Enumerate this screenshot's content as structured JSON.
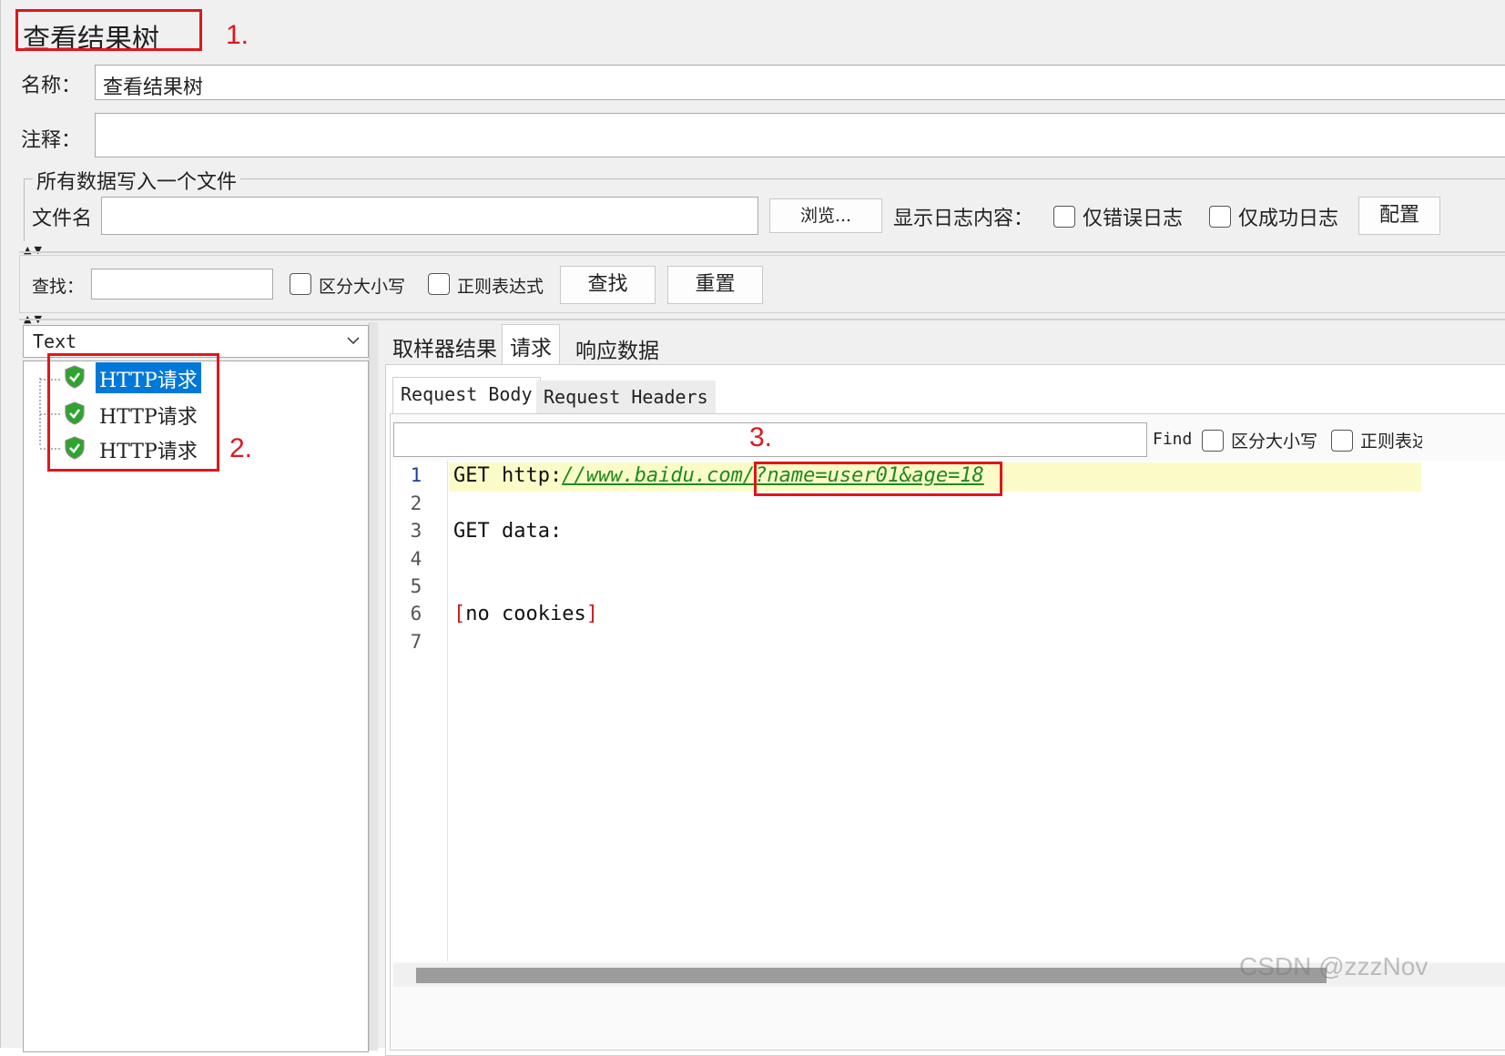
{
  "title": "查看结果树",
  "annotations": [
    "1.",
    "2.",
    "3."
  ],
  "name_label": "名称：",
  "name_value": "查看结果树",
  "comment_label": "注释：",
  "comment_value": "",
  "file_section": {
    "legend": "所有数据写入一个文件",
    "filename_label": "文件名",
    "filename_value": "",
    "browse_button": "浏览...",
    "log_content_label": "显示日志内容：",
    "errors_only": "仅错误日志",
    "success_only": "仅成功日志",
    "config_button": "配置"
  },
  "search_bar": {
    "label": "查找：",
    "value": "",
    "case_sensitive": "区分大小写",
    "regex": "正则表达式",
    "find_button": "查找",
    "reset_button": "重置"
  },
  "renderer": {
    "selected": "Text"
  },
  "tree": {
    "items": [
      "HTTP请求",
      "HTTP请求",
      "HTTP请求"
    ]
  },
  "result_tabs": [
    "取样器结果",
    "请求",
    "响应数据"
  ],
  "request_tabs": [
    "Request Body",
    "Request Headers"
  ],
  "find_bar": {
    "value": "",
    "find_label": "Find",
    "case_sensitive": "区分大小写",
    "regex": "正则表达"
  },
  "code": {
    "line_numbers": [
      "1",
      "2",
      "3",
      "4",
      "5",
      "6",
      "7"
    ],
    "line1_method": "GET http:",
    "line1_url": "//www.baidu.com/",
    "line1_query": "?name=user01&age=18",
    "line3": "GET data:",
    "line6_open": "[",
    "line6_text": "no cookies",
    "line6_close": "]"
  },
  "watermark": "CSDN @zzzNov",
  "colors": {
    "annotation_red": "#e0161b",
    "selection_blue": "#0078d7",
    "highlight_line": "#fbfbc8",
    "link_green": "#1e8a1e"
  }
}
